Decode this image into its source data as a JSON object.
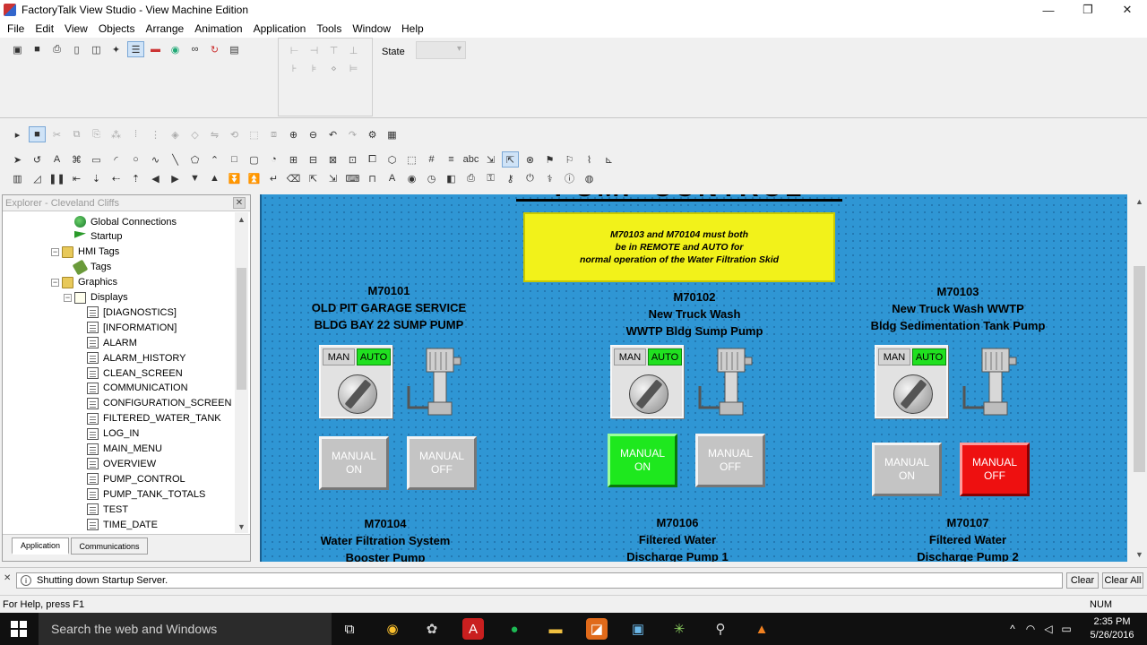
{
  "window": {
    "title": "FactoryTalk View Studio - View Machine Edition",
    "min": "—",
    "max": "❐",
    "close": "✕"
  },
  "menu": [
    "File",
    "Edit",
    "View",
    "Objects",
    "Arrange",
    "Animation",
    "Application",
    "Tools",
    "Window",
    "Help"
  ],
  "toolbar": {
    "state_label": "State",
    "state_value": ""
  },
  "explorer": {
    "title": "Explorer - Cleveland Cliffs",
    "close": "✕",
    "items": [
      {
        "label": "Global Connections",
        "icon": "globe-icon"
      },
      {
        "label": "Startup",
        "icon": "flag-icon"
      },
      {
        "label": "HMI Tags",
        "icon": "folder-icon"
      },
      {
        "label": "Tags",
        "icon": "tag-icon"
      },
      {
        "label": "Graphics",
        "icon": "folder-icon"
      },
      {
        "label": "Displays",
        "icon": "displays-icon"
      },
      {
        "label": "[DIAGNOSTICS]",
        "icon": "document-icon"
      },
      {
        "label": "[INFORMATION]",
        "icon": "document-icon"
      },
      {
        "label": "ALARM",
        "icon": "document-icon"
      },
      {
        "label": "ALARM_HISTORY",
        "icon": "document-icon"
      },
      {
        "label": "CLEAN_SCREEN",
        "icon": "document-icon"
      },
      {
        "label": "COMMUNICATION",
        "icon": "document-icon"
      },
      {
        "label": "CONFIGURATION_SCREEN",
        "icon": "document-icon"
      },
      {
        "label": "FILTERED_WATER_TANK",
        "icon": "document-icon"
      },
      {
        "label": "LOG_IN",
        "icon": "document-icon"
      },
      {
        "label": "MAIN_MENU",
        "icon": "document-icon"
      },
      {
        "label": "OVERVIEW",
        "icon": "document-icon"
      },
      {
        "label": "PUMP_CONTROL",
        "icon": "document-icon"
      },
      {
        "label": "PUMP_TANK_TOTALS",
        "icon": "document-icon"
      },
      {
        "label": "TEST",
        "icon": "document-icon"
      },
      {
        "label": "TIME_DATE",
        "icon": "document-icon"
      }
    ],
    "tabs": [
      "Application",
      "Communications"
    ]
  },
  "display": {
    "title_partial": "PUMP CONTROL",
    "note_lines": [
      "M70103 and M70104 must both",
      "be in REMOTE and AUTO for",
      "normal operation of the Water Filtration Skid"
    ],
    "pumps": [
      {
        "id": "M70101",
        "line1": "OLD PIT GARAGE SERVICE",
        "line2": "BLDG BAY 22 SUMP PUMP",
        "man": "MAN",
        "auto": "AUTO",
        "on_l1": "MANUAL",
        "on_l2": "ON",
        "off_l1": "MANUAL",
        "off_l2": "OFF",
        "state": "none"
      },
      {
        "id": "M70102",
        "line1": "New Truck Wash",
        "line2": "WWTP Bldg Sump Pump",
        "man": "MAN",
        "auto": "AUTO",
        "on_l1": "MANUAL",
        "on_l2": "ON",
        "off_l1": "MANUAL",
        "off_l2": "OFF",
        "state": "on"
      },
      {
        "id": "M70103",
        "line1": "New Truck Wash WWTP",
        "line2": "Bldg Sedimentation Tank Pump",
        "man": "MAN",
        "auto": "AUTO",
        "on_l1": "MANUAL",
        "on_l2": "ON",
        "off_l1": "MANUAL",
        "off_l2": "OFF",
        "state": "off"
      }
    ],
    "pumps_row2": [
      {
        "id": "M70104",
        "line1": "Water Filtration System",
        "line2": "Booster Pump"
      },
      {
        "id": "M70106",
        "line1": "Filtered Water",
        "line2": "Discharge Pump 1"
      },
      {
        "id": "M70107",
        "line1": "Filtered Water",
        "line2": "Discharge Pump 2"
      }
    ]
  },
  "output": {
    "message": "Shutting down Startup Server.",
    "clear": "Clear",
    "clear_all": "Clear All"
  },
  "status": {
    "help": "For Help, press F1",
    "num": "NUM"
  },
  "taskbar": {
    "search_placeholder": "Search the web and Windows",
    "time": "2:35 PM",
    "date": "5/26/2016"
  },
  "colors": {
    "canvas": "#2f96d4",
    "note": "#f2f21a",
    "auto_active": "#20e020",
    "manual_on_active": "#1ee81e",
    "manual_off_active": "#ee1010",
    "button_inactive": "#c4c4c4"
  }
}
